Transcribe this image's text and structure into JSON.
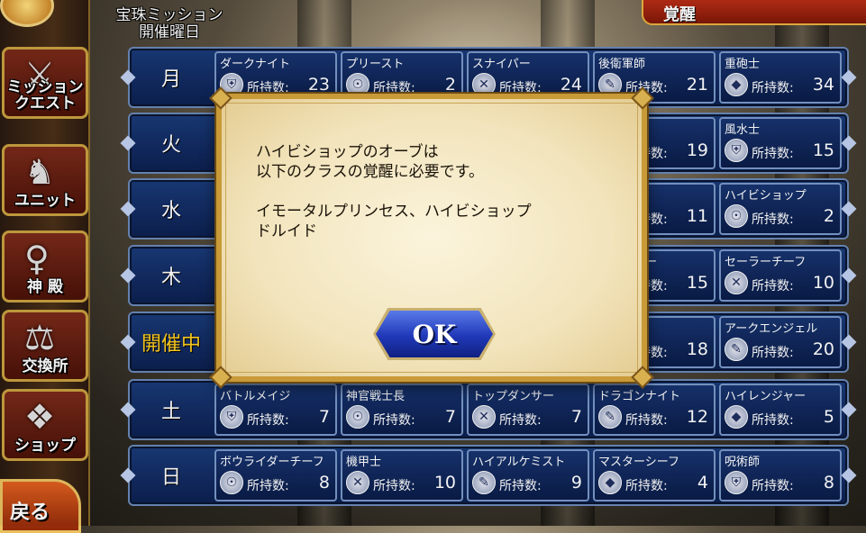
{
  "header": {
    "title_line1": "宝珠ミッション",
    "title_line2": "開催曜日",
    "tab": "覚醒"
  },
  "sidebar": {
    "items": [
      {
        "label": "ミッション\nクエスト",
        "icon": "crossed-swords-icon"
      },
      {
        "label": "ユニット",
        "icon": "knight-icon"
      },
      {
        "label": "神 殿",
        "icon": "goddess-icon"
      },
      {
        "label": "交換所",
        "icon": "scales-icon"
      },
      {
        "label": "ショップ",
        "icon": "crystal-icon"
      }
    ],
    "back": "戻る"
  },
  "count_label": "所持数:",
  "rows": [
    {
      "day": "月",
      "active": false,
      "cells": [
        {
          "name": "ダークナイト",
          "count": "23"
        },
        {
          "name": "プリースト",
          "count": "2"
        },
        {
          "name": "スナイパー",
          "count": "24"
        },
        {
          "name": "後衛軍師",
          "count": "21"
        },
        {
          "name": "重砲士",
          "count": "34"
        }
      ]
    },
    {
      "day": "火",
      "active": false,
      "cells": [
        {
          "name": "",
          "count": ""
        },
        {
          "name": "",
          "count": ""
        },
        {
          "name": "",
          "count": ""
        },
        {
          "name": "カー",
          "count": "19"
        },
        {
          "name": "風水士",
          "count": "15"
        }
      ]
    },
    {
      "day": "水",
      "active": false,
      "cells": [
        {
          "name": "",
          "count": ""
        },
        {
          "name": "",
          "count": ""
        },
        {
          "name": "",
          "count": ""
        },
        {
          "name": "ーマン",
          "count": "11"
        },
        {
          "name": "ハイビショップ",
          "count": "2"
        }
      ]
    },
    {
      "day": "木",
      "active": false,
      "cells": [
        {
          "name": "",
          "count": ""
        },
        {
          "name": "",
          "count": ""
        },
        {
          "name": "",
          "count": ""
        },
        {
          "name": "イアキラー",
          "count": "15"
        },
        {
          "name": "セーラーチーフ",
          "count": "10"
        }
      ]
    },
    {
      "day": "開催中",
      "active": true,
      "cells": [
        {
          "name": "",
          "count": ""
        },
        {
          "name": "",
          "count": ""
        },
        {
          "name": "",
          "count": ""
        },
        {
          "name": "ィッチ",
          "count": "18"
        },
        {
          "name": "アークエンジェル",
          "count": "20"
        }
      ]
    },
    {
      "day": "土",
      "active": false,
      "cells": [
        {
          "name": "バトルメイジ",
          "count": "7"
        },
        {
          "name": "神官戦士長",
          "count": "7"
        },
        {
          "name": "トップダンサー",
          "count": "7"
        },
        {
          "name": "ドラゴンナイト",
          "count": "12"
        },
        {
          "name": "ハイレンジャー",
          "count": "5"
        }
      ]
    },
    {
      "day": "日",
      "active": false,
      "cells": [
        {
          "name": "ボウライダーチーフ",
          "count": "8"
        },
        {
          "name": "機甲士",
          "count": "10"
        },
        {
          "name": "ハイアルケミスト",
          "count": "9"
        },
        {
          "name": "マスターシーフ",
          "count": "4"
        },
        {
          "name": "呪術師",
          "count": "8"
        }
      ]
    }
  ],
  "dialog": {
    "line1": "ハイビショップのオーブは",
    "line2": "以下のクラスの覚醒に必要です。",
    "line3": "イモータルプリンセス、ハイビショップ",
    "line4": "ドルイド",
    "ok": "OK"
  }
}
